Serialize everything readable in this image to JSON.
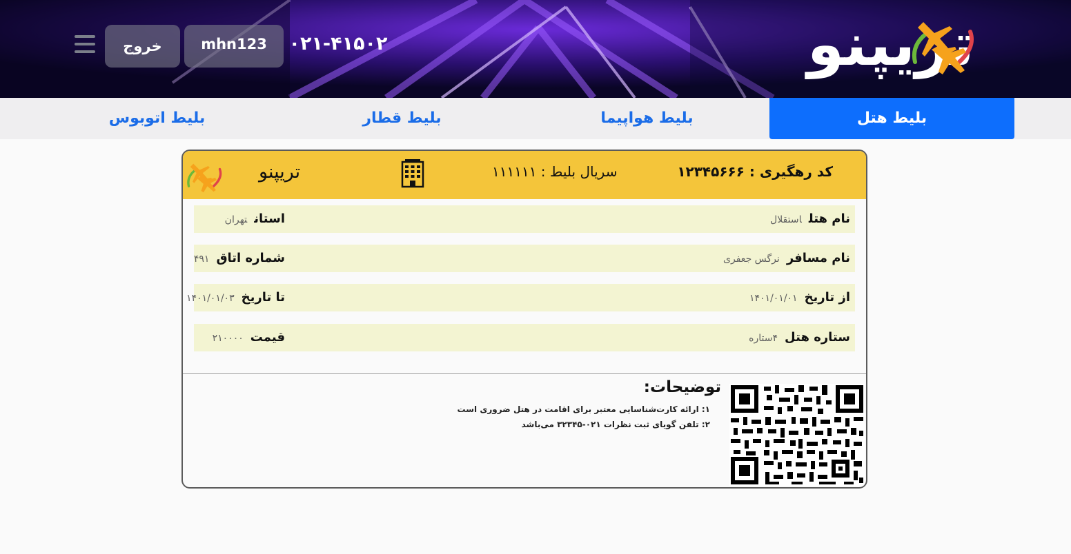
{
  "header": {
    "brand": "تریپنو",
    "phone": "۰۲۱-۴۱۵۰۲",
    "user_label": "mhn123",
    "logout_label": "خروج"
  },
  "nav": {
    "tabs": [
      {
        "label": "بلیط هتل",
        "active": true
      },
      {
        "label": "بلیط هواپیما",
        "active": false
      },
      {
        "label": "بلیط قطار",
        "active": false
      },
      {
        "label": "بلیط اتوبوس",
        "active": false
      }
    ]
  },
  "ticket": {
    "tracking": "کد رهگیری : ۱۲۳۴۵۶۶۶",
    "serial": "سریال بلیط : ۱۱۱۱۱۱",
    "brand": "تریپنو",
    "rows": [
      {
        "label_r": "نام هتل",
        "value_r": "استقلال",
        "label_l": "استان",
        "value_l": "تهران"
      },
      {
        "label_r": "نام مسافر",
        "value_r": "نرگس جعفری",
        "label_l": "شماره اتاق",
        "value_l": "۴۹۱"
      },
      {
        "label_r": "از تاریخ",
        "value_r": "۱۴۰۱/۰۱/۰۱",
        "label_l": "تا تاریخ",
        "value_l": "۱۴۰۱/۰۱/۰۳"
      },
      {
        "label_r": "ستاره هتل",
        "value_r": "۴ستاره",
        "label_l": "قیمت",
        "value_l": "۲۱۰۰۰۰"
      }
    ],
    "description_title": "توضیحات:",
    "description_lines": [
      "۱: ارائه کارت‌شناسایی معتبر برای اقامت در هتل ضروری است",
      "۲: تلفن گویای ثبت نظرات ۰۲۱-۳۲۳۴۵ می‌باشد"
    ]
  },
  "colors": {
    "header_bg": "#130a3a",
    "accent": "#0d6efd",
    "ticket_head": "#f4c53a",
    "row_bg": "#f3f4d2"
  },
  "icons": [
    "menu-icon",
    "building-icon",
    "plane-logo-icon",
    "qr-code"
  ]
}
